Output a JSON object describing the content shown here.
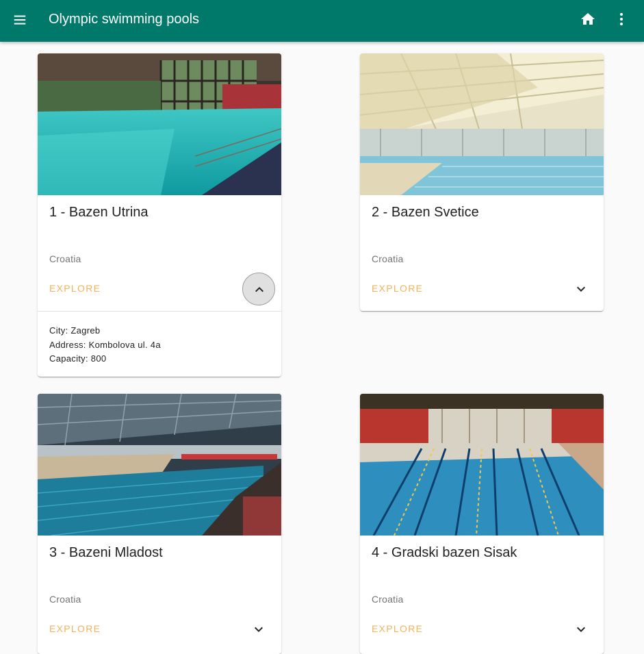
{
  "appbar": {
    "title": "Olympic swimming pools",
    "menu_icon": "menu-icon",
    "home_icon": "home-icon",
    "more_icon": "more-vert-icon",
    "color": "#00796b"
  },
  "cards": [
    {
      "title": "1 - Bazen Utrina",
      "country": "Croatia",
      "action": "EXPLORE",
      "expanded": true,
      "details": {
        "city": "City: Zagreb",
        "address": "Address: Kombolova ul. 4a",
        "capacity": "Capacity: 800"
      }
    },
    {
      "title": "2 - Bazen Svetice",
      "country": "Croatia",
      "action": "EXPLORE",
      "expanded": false
    },
    {
      "title": "3 - Bazeni Mladost",
      "country": "Croatia",
      "action": "EXPLORE",
      "expanded": false
    },
    {
      "title": "4 - Gradski bazen Sisak",
      "country": "Croatia",
      "action": "EXPLORE",
      "expanded": false
    }
  ],
  "colors": {
    "accent": "#f2b35b",
    "secondary_text": "#757575"
  }
}
